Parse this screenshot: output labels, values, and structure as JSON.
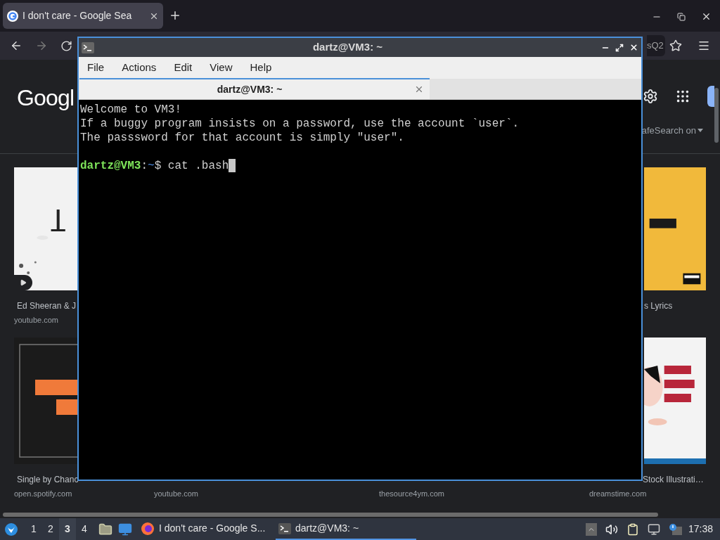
{
  "browser": {
    "tabs": [
      {
        "title": "I don't care - Google Sea",
        "selected": true
      }
    ],
    "address_fragment": "sQ2",
    "logo": "Googl",
    "safesearch": "afeSearch on",
    "result_rows": [
      [
        {
          "kind": "picture",
          "title": "Ed Sheeran & J",
          "source": "youtube.com",
          "video": true
        },
        {
          "kind": "picture",
          "title": "s Lyrics",
          "video": false
        }
      ],
      [
        {
          "kind": "picture",
          "title": "Single by Chanc",
          "source": "open.spotify.com"
        },
        {
          "kind": "link",
          "source": "youtube.com"
        },
        {
          "kind": "link",
          "source": "thesource4ym.com"
        },
        {
          "kind": "picture",
          "title": "Stock Illustrati…",
          "source": "dreamstime.com"
        }
      ]
    ]
  },
  "terminal": {
    "title": "dartz@VM3: ~",
    "menu": [
      "File",
      "Actions",
      "Edit",
      "View",
      "Help"
    ],
    "tabs": [
      {
        "title": "dartz@VM3: ~",
        "selected": true
      }
    ],
    "lines": [
      "Welcome to VM3!",
      "If a buggy program insists on a password, use the account `user`.",
      "The passsword for that account is simply \"user\"."
    ],
    "prompt": {
      "user_host": "dartz@VM3",
      "separator": ":",
      "path": "~",
      "symbol": "$",
      "command": "cat .bash"
    }
  },
  "taskbar": {
    "workspaces": [
      {
        "label": "1",
        "selected": false
      },
      {
        "label": "2",
        "selected": false
      },
      {
        "label": "3",
        "selected": true
      },
      {
        "label": "4",
        "selected": false
      }
    ],
    "tasks": [
      {
        "kind": "browser",
        "title": "I don't care - Google S...",
        "selected": false
      },
      {
        "kind": "terminal",
        "title": "dartz@VM3: ~",
        "selected": true
      }
    ],
    "clock": "17:38"
  }
}
